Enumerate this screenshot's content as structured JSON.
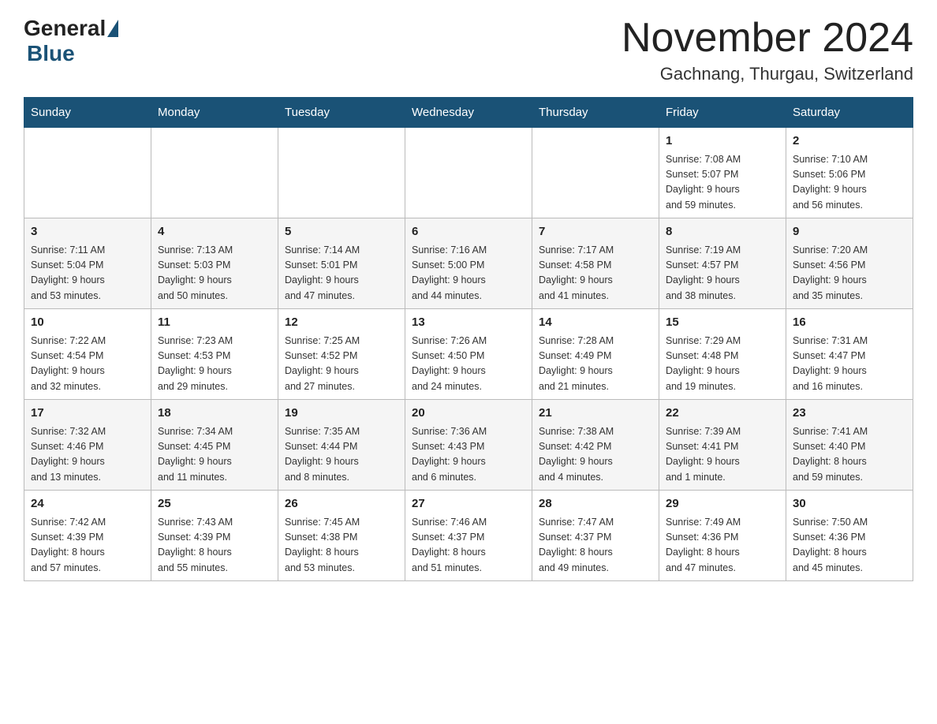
{
  "header": {
    "logo_general": "General",
    "logo_blue": "Blue",
    "month_title": "November 2024",
    "location": "Gachnang, Thurgau, Switzerland"
  },
  "weekdays": [
    "Sunday",
    "Monday",
    "Tuesday",
    "Wednesday",
    "Thursday",
    "Friday",
    "Saturday"
  ],
  "weeks": [
    [
      {
        "day": "",
        "info": ""
      },
      {
        "day": "",
        "info": ""
      },
      {
        "day": "",
        "info": ""
      },
      {
        "day": "",
        "info": ""
      },
      {
        "day": "",
        "info": ""
      },
      {
        "day": "1",
        "info": "Sunrise: 7:08 AM\nSunset: 5:07 PM\nDaylight: 9 hours\nand 59 minutes."
      },
      {
        "day": "2",
        "info": "Sunrise: 7:10 AM\nSunset: 5:06 PM\nDaylight: 9 hours\nand 56 minutes."
      }
    ],
    [
      {
        "day": "3",
        "info": "Sunrise: 7:11 AM\nSunset: 5:04 PM\nDaylight: 9 hours\nand 53 minutes."
      },
      {
        "day": "4",
        "info": "Sunrise: 7:13 AM\nSunset: 5:03 PM\nDaylight: 9 hours\nand 50 minutes."
      },
      {
        "day": "5",
        "info": "Sunrise: 7:14 AM\nSunset: 5:01 PM\nDaylight: 9 hours\nand 47 minutes."
      },
      {
        "day": "6",
        "info": "Sunrise: 7:16 AM\nSunset: 5:00 PM\nDaylight: 9 hours\nand 44 minutes."
      },
      {
        "day": "7",
        "info": "Sunrise: 7:17 AM\nSunset: 4:58 PM\nDaylight: 9 hours\nand 41 minutes."
      },
      {
        "day": "8",
        "info": "Sunrise: 7:19 AM\nSunset: 4:57 PM\nDaylight: 9 hours\nand 38 minutes."
      },
      {
        "day": "9",
        "info": "Sunrise: 7:20 AM\nSunset: 4:56 PM\nDaylight: 9 hours\nand 35 minutes."
      }
    ],
    [
      {
        "day": "10",
        "info": "Sunrise: 7:22 AM\nSunset: 4:54 PM\nDaylight: 9 hours\nand 32 minutes."
      },
      {
        "day": "11",
        "info": "Sunrise: 7:23 AM\nSunset: 4:53 PM\nDaylight: 9 hours\nand 29 minutes."
      },
      {
        "day": "12",
        "info": "Sunrise: 7:25 AM\nSunset: 4:52 PM\nDaylight: 9 hours\nand 27 minutes."
      },
      {
        "day": "13",
        "info": "Sunrise: 7:26 AM\nSunset: 4:50 PM\nDaylight: 9 hours\nand 24 minutes."
      },
      {
        "day": "14",
        "info": "Sunrise: 7:28 AM\nSunset: 4:49 PM\nDaylight: 9 hours\nand 21 minutes."
      },
      {
        "day": "15",
        "info": "Sunrise: 7:29 AM\nSunset: 4:48 PM\nDaylight: 9 hours\nand 19 minutes."
      },
      {
        "day": "16",
        "info": "Sunrise: 7:31 AM\nSunset: 4:47 PM\nDaylight: 9 hours\nand 16 minutes."
      }
    ],
    [
      {
        "day": "17",
        "info": "Sunrise: 7:32 AM\nSunset: 4:46 PM\nDaylight: 9 hours\nand 13 minutes."
      },
      {
        "day": "18",
        "info": "Sunrise: 7:34 AM\nSunset: 4:45 PM\nDaylight: 9 hours\nand 11 minutes."
      },
      {
        "day": "19",
        "info": "Sunrise: 7:35 AM\nSunset: 4:44 PM\nDaylight: 9 hours\nand 8 minutes."
      },
      {
        "day": "20",
        "info": "Sunrise: 7:36 AM\nSunset: 4:43 PM\nDaylight: 9 hours\nand 6 minutes."
      },
      {
        "day": "21",
        "info": "Sunrise: 7:38 AM\nSunset: 4:42 PM\nDaylight: 9 hours\nand 4 minutes."
      },
      {
        "day": "22",
        "info": "Sunrise: 7:39 AM\nSunset: 4:41 PM\nDaylight: 9 hours\nand 1 minute."
      },
      {
        "day": "23",
        "info": "Sunrise: 7:41 AM\nSunset: 4:40 PM\nDaylight: 8 hours\nand 59 minutes."
      }
    ],
    [
      {
        "day": "24",
        "info": "Sunrise: 7:42 AM\nSunset: 4:39 PM\nDaylight: 8 hours\nand 57 minutes."
      },
      {
        "day": "25",
        "info": "Sunrise: 7:43 AM\nSunset: 4:39 PM\nDaylight: 8 hours\nand 55 minutes."
      },
      {
        "day": "26",
        "info": "Sunrise: 7:45 AM\nSunset: 4:38 PM\nDaylight: 8 hours\nand 53 minutes."
      },
      {
        "day": "27",
        "info": "Sunrise: 7:46 AM\nSunset: 4:37 PM\nDaylight: 8 hours\nand 51 minutes."
      },
      {
        "day": "28",
        "info": "Sunrise: 7:47 AM\nSunset: 4:37 PM\nDaylight: 8 hours\nand 49 minutes."
      },
      {
        "day": "29",
        "info": "Sunrise: 7:49 AM\nSunset: 4:36 PM\nDaylight: 8 hours\nand 47 minutes."
      },
      {
        "day": "30",
        "info": "Sunrise: 7:50 AM\nSunset: 4:36 PM\nDaylight: 8 hours\nand 45 minutes."
      }
    ]
  ]
}
